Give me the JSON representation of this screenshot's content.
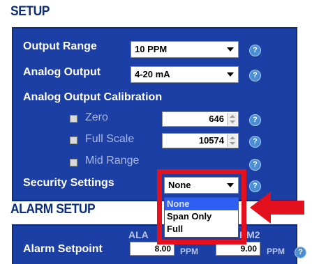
{
  "setup": {
    "title": "SETUP",
    "output_range": {
      "label": "Output Range",
      "value": "10 PPM"
    },
    "analog_output": {
      "label": "Analog Output",
      "value": "4-20 mA"
    },
    "calibration": {
      "label": "Analog Output Calibration",
      "zero": {
        "label": "Zero",
        "value": "646"
      },
      "full_scale": {
        "label": "Full Scale",
        "value": "10574"
      },
      "mid_range": {
        "label": "Mid Range"
      }
    },
    "security": {
      "label": "Security Settings",
      "value": "None",
      "options": [
        "None",
        "Span Only",
        "Full"
      ],
      "highlighted": "None"
    },
    "help_glyph": "?"
  },
  "alarm_setup": {
    "title": "ALARM SETUP",
    "col1": "ALA",
    "col2": "RM2",
    "setpoint": {
      "label": "Alarm Setpoint",
      "alarm1": "8.00",
      "alarm2": "9.00",
      "unit": "PPM"
    }
  },
  "annotation": {
    "highlight_color": "#e3101d",
    "arrow_color": "#e3101d"
  }
}
